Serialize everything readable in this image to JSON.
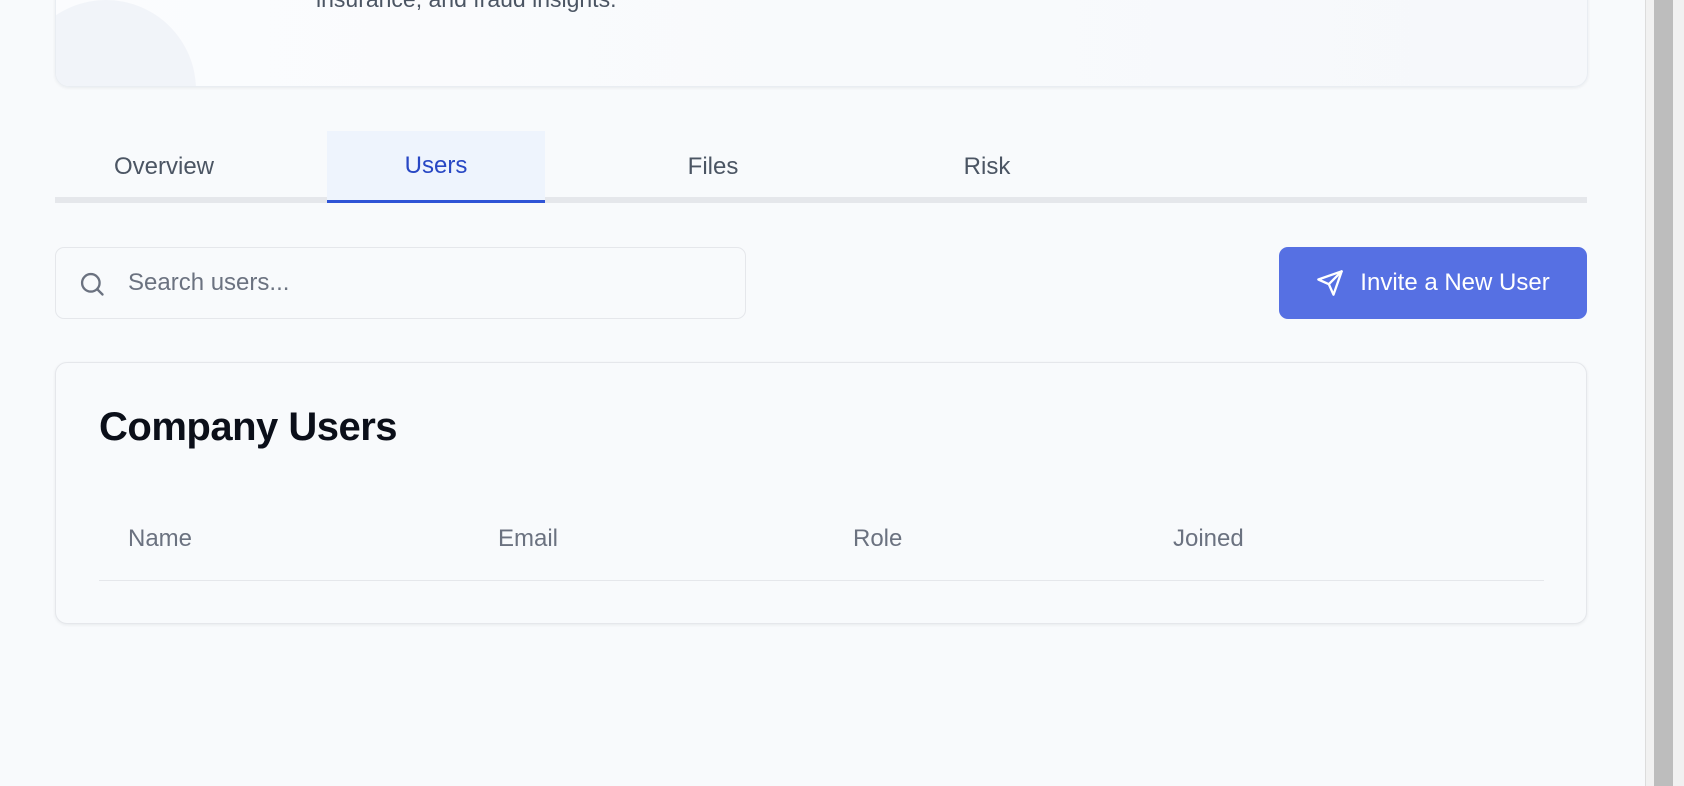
{
  "header": {
    "subtitle": "insurance, and fraud insights."
  },
  "tabs": [
    {
      "label": "Overview",
      "active": false
    },
    {
      "label": "Users",
      "active": true
    },
    {
      "label": "Files",
      "active": false
    },
    {
      "label": "Risk",
      "active": false
    }
  ],
  "search": {
    "placeholder": "Search users...",
    "value": "",
    "icon": "search-icon"
  },
  "invite_button": {
    "label": "Invite a New User",
    "icon": "send-icon"
  },
  "users_card": {
    "title": "Company Users",
    "columns": [
      "Name",
      "Email",
      "Role",
      "Joined"
    ],
    "rows": []
  },
  "colors": {
    "accent": "#5670e3",
    "active_tab_text": "#2747c4",
    "active_tab_bg": "#eef4fd",
    "page_bg": "#f8fafc"
  }
}
